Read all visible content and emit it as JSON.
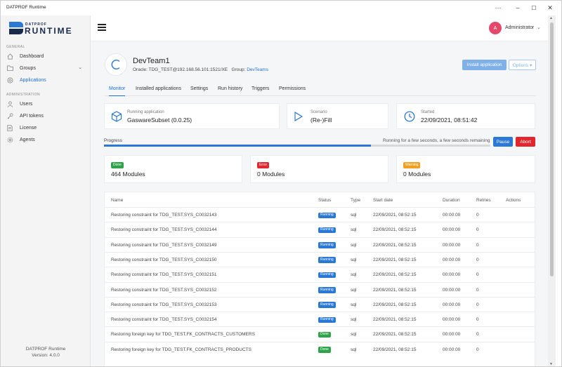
{
  "window": {
    "title": "DATPROF Runtime",
    "controls": {
      "more": "···",
      "minimize": "–",
      "maximize": "☐",
      "close": "✕"
    }
  },
  "sidebar": {
    "logo_small": "DATPROF",
    "logo_big": "RUNTIME",
    "general_title": "GENERAL",
    "admin_title": "ADMINISTRATION",
    "general_items": [
      {
        "label": "Dashboard",
        "icon": "home-icon"
      },
      {
        "label": "Groups",
        "icon": "folder-icon"
      },
      {
        "label": "Applications",
        "icon": "applications-icon"
      }
    ],
    "admin_items": [
      {
        "label": "Users",
        "icon": "user-icon"
      },
      {
        "label": "API tokens",
        "icon": "key-icon"
      },
      {
        "label": "License",
        "icon": "document-icon"
      },
      {
        "label": "Agents",
        "icon": "gear-icon"
      }
    ],
    "footer_name": "DATPROF Runtime",
    "footer_version": "Version: 4.0.0"
  },
  "header": {
    "avatar_letter": "A",
    "user_name": "Administrator"
  },
  "team": {
    "name": "DevTeam1",
    "connection": "Oracle: TDG_TEST@192.168.56.101:1521/XE",
    "group_label": "Group:",
    "group_value": "DevTeams",
    "install_button": "Install application",
    "options_button": "Options ▾"
  },
  "tabs": [
    "Monitor",
    "Installed applications",
    "Settings",
    "Run history",
    "Triggers",
    "Permissions"
  ],
  "info_cards": {
    "running_label": "Running application",
    "running_value": "GaswareSubset (0.0.25)",
    "scenario_label": "Scenario",
    "scenario_value": "(Re-)Fill",
    "started_label": "Started",
    "started_value": "22/09/2021, 08:51:42"
  },
  "progress": {
    "label": "Progress",
    "status": "Running for a few seconds, a few seconds remaining",
    "fraction": 0.69,
    "pause_button": "Pause",
    "abort_button": "Abort"
  },
  "summary": {
    "done_badge": "Done",
    "done_value": "464 Modules",
    "error_badge": "Error",
    "error_value": "0 Modules",
    "warning_badge": "Warning",
    "warning_value": "0 Modules"
  },
  "table": {
    "headers": [
      "Name",
      "Status",
      "Type",
      "Start date",
      "Duration",
      "Retries",
      "Actions"
    ],
    "rows": [
      {
        "name": "Restoring constraint for TDG_TEST.SYS_C0032143",
        "status": "Running",
        "type": "sql",
        "start": "22/09/2021, 08:52:15",
        "duration": "00:00:00",
        "retries": "0"
      },
      {
        "name": "Restoring constraint for TDG_TEST.SYS_C0032144",
        "status": "Running",
        "type": "sql",
        "start": "22/09/2021, 08:52:15",
        "duration": "00:00:00",
        "retries": "0"
      },
      {
        "name": "Restoring constraint for TDG_TEST.SYS_C0032149",
        "status": "Running",
        "type": "sql",
        "start": "22/09/2021, 08:52:15",
        "duration": "00:00:00",
        "retries": "0"
      },
      {
        "name": "Restoring constraint for TDG_TEST.SYS_C0032150",
        "status": "Running",
        "type": "sql",
        "start": "22/09/2021, 08:52:15",
        "duration": "00:00:00",
        "retries": "0"
      },
      {
        "name": "Restoring constraint for TDG_TEST.SYS_C0032151",
        "status": "Running",
        "type": "sql",
        "start": "22/09/2021, 08:52:15",
        "duration": "00:00:00",
        "retries": "0"
      },
      {
        "name": "Restoring constraint for TDG_TEST.SYS_C0032152",
        "status": "Running",
        "type": "sql",
        "start": "22/09/2021, 08:52:15",
        "duration": "00:00:00",
        "retries": "0"
      },
      {
        "name": "Restoring constraint for TDG_TEST.SYS_C0032153",
        "status": "Running",
        "type": "sql",
        "start": "22/09/2021, 08:52:15",
        "duration": "00:00:00",
        "retries": "0"
      },
      {
        "name": "Restoring constraint for TDG_TEST.SYS_C0032154",
        "status": "Running",
        "type": "sql",
        "start": "22/09/2021, 08:52:15",
        "duration": "00:00:00",
        "retries": "0"
      },
      {
        "name": "Restoring foreign key for TDG_TEST.FK_CONTRACTS_CUSTOMERS",
        "status": "Done",
        "type": "sql",
        "start": "22/09/2021, 08:52:15",
        "duration": "00:00:00",
        "retries": "0"
      },
      {
        "name": "Restoring foreign key for TDG_TEST.FK_CONTRACTS_PRODUCTS",
        "status": "Done",
        "type": "sql",
        "start": "22/09/2021, 08:52:15",
        "duration": "00:00:00",
        "retries": "0"
      }
    ]
  },
  "colors": {
    "accent": "#1d6fd1",
    "running": "#2b79d5",
    "done": "#2fa34a",
    "error": "#e2262e",
    "warning": "#f0a020",
    "avatar": "#e5476b"
  }
}
